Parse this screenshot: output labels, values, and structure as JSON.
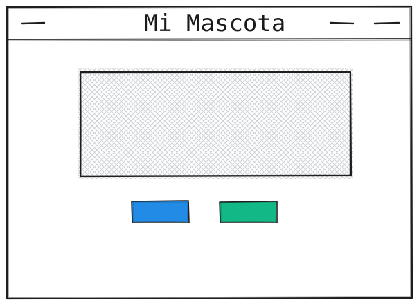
{
  "window": {
    "title": "Mi Mascota"
  },
  "image_placeholder": {
    "fill": "#d9dcdf"
  },
  "buttons": {
    "primary_color": "#228be6",
    "secondary_color": "#12b886"
  },
  "colors": {
    "stroke": "#1e1e1e",
    "background": "#ffffff"
  },
  "icons": {
    "left": "minimize-dash-icon",
    "right_1": "minimize-dash-icon",
    "right_2": "close-dash-icon"
  }
}
